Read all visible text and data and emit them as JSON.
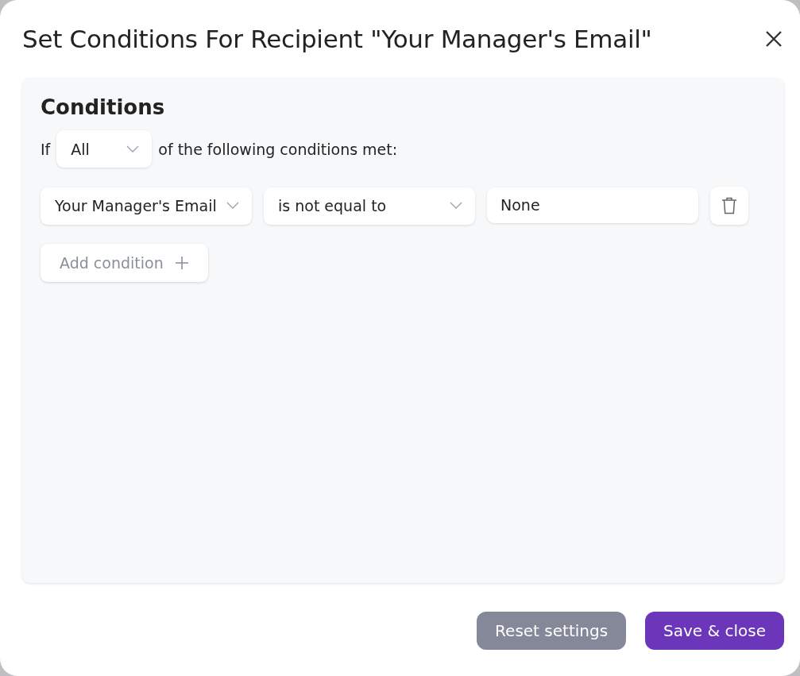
{
  "dialog": {
    "title": "Set Conditions For Recipient \"Your Manager's Email\""
  },
  "conditions": {
    "heading": "Conditions",
    "prefix": "If",
    "match": {
      "value": "All"
    },
    "suffix": "of the following conditions met:",
    "rows": [
      {
        "field": "Your Manager's Email",
        "operator": "is not equal to",
        "value": "None"
      }
    ],
    "add_button": "Add condition"
  },
  "buttons": [
    {
      "label": "Reset settings",
      "kind": "secondary"
    },
    {
      "label": "Save & close",
      "kind": "primary"
    }
  ]
}
